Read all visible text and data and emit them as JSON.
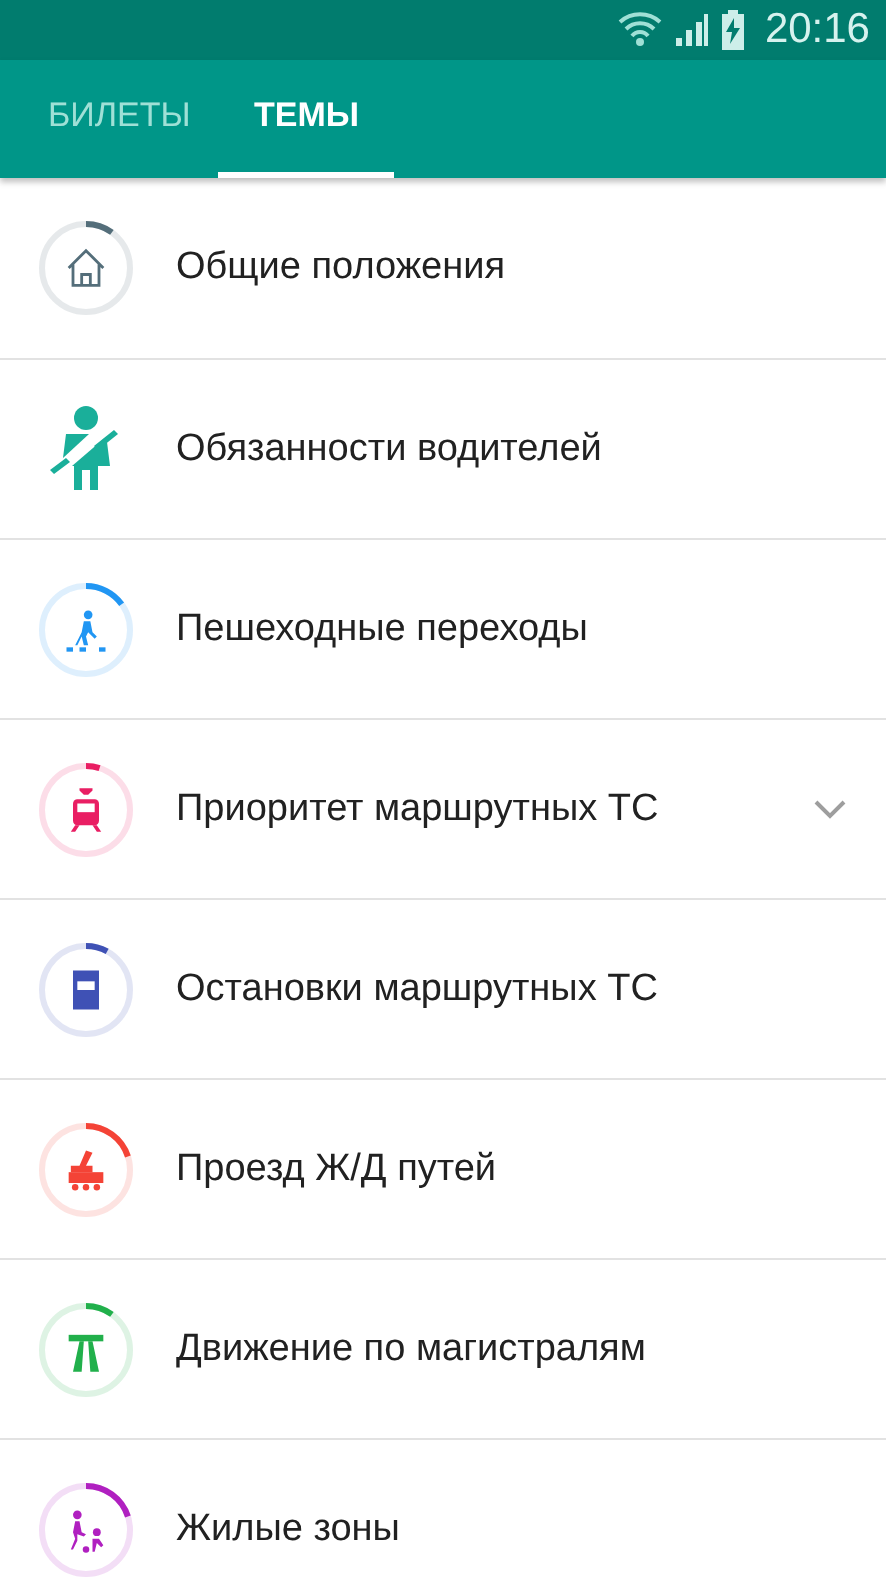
{
  "status_bar": {
    "time": "20:16"
  },
  "tabs": [
    {
      "label": "БИЛЕТЫ",
      "selected": false
    },
    {
      "label": "ТЕМЫ",
      "selected": true
    }
  ],
  "topics": [
    {
      "title": "Общие положения",
      "kind": "ring",
      "color": "#546e7a",
      "level": 0.1,
      "expandable": false
    },
    {
      "title": "Обязанности водителей",
      "kind": "plain",
      "color": "#1aaf9a",
      "expandable": false
    },
    {
      "title": "Пешеходные переходы",
      "kind": "ring",
      "color": "#2196f3",
      "level": 0.15,
      "expandable": false
    },
    {
      "title": "Приоритет маршрутных ТС",
      "kind": "ring",
      "color": "#e91e63",
      "level": 0.05,
      "expandable": true
    },
    {
      "title": "Остановки маршрутных ТС",
      "kind": "ring",
      "color": "#3f51b5",
      "level": 0.08,
      "expandable": false
    },
    {
      "title": "Проезд Ж/Д путей",
      "kind": "ring",
      "color": "#f44336",
      "level": 0.2,
      "expandable": false
    },
    {
      "title": "Движение по магистралям",
      "kind": "ring",
      "color": "#21b04b",
      "level": 0.1,
      "expandable": false
    },
    {
      "title": "Жилые зоны",
      "kind": "ring",
      "color": "#b020c0",
      "level": 0.2,
      "expandable": false
    }
  ]
}
